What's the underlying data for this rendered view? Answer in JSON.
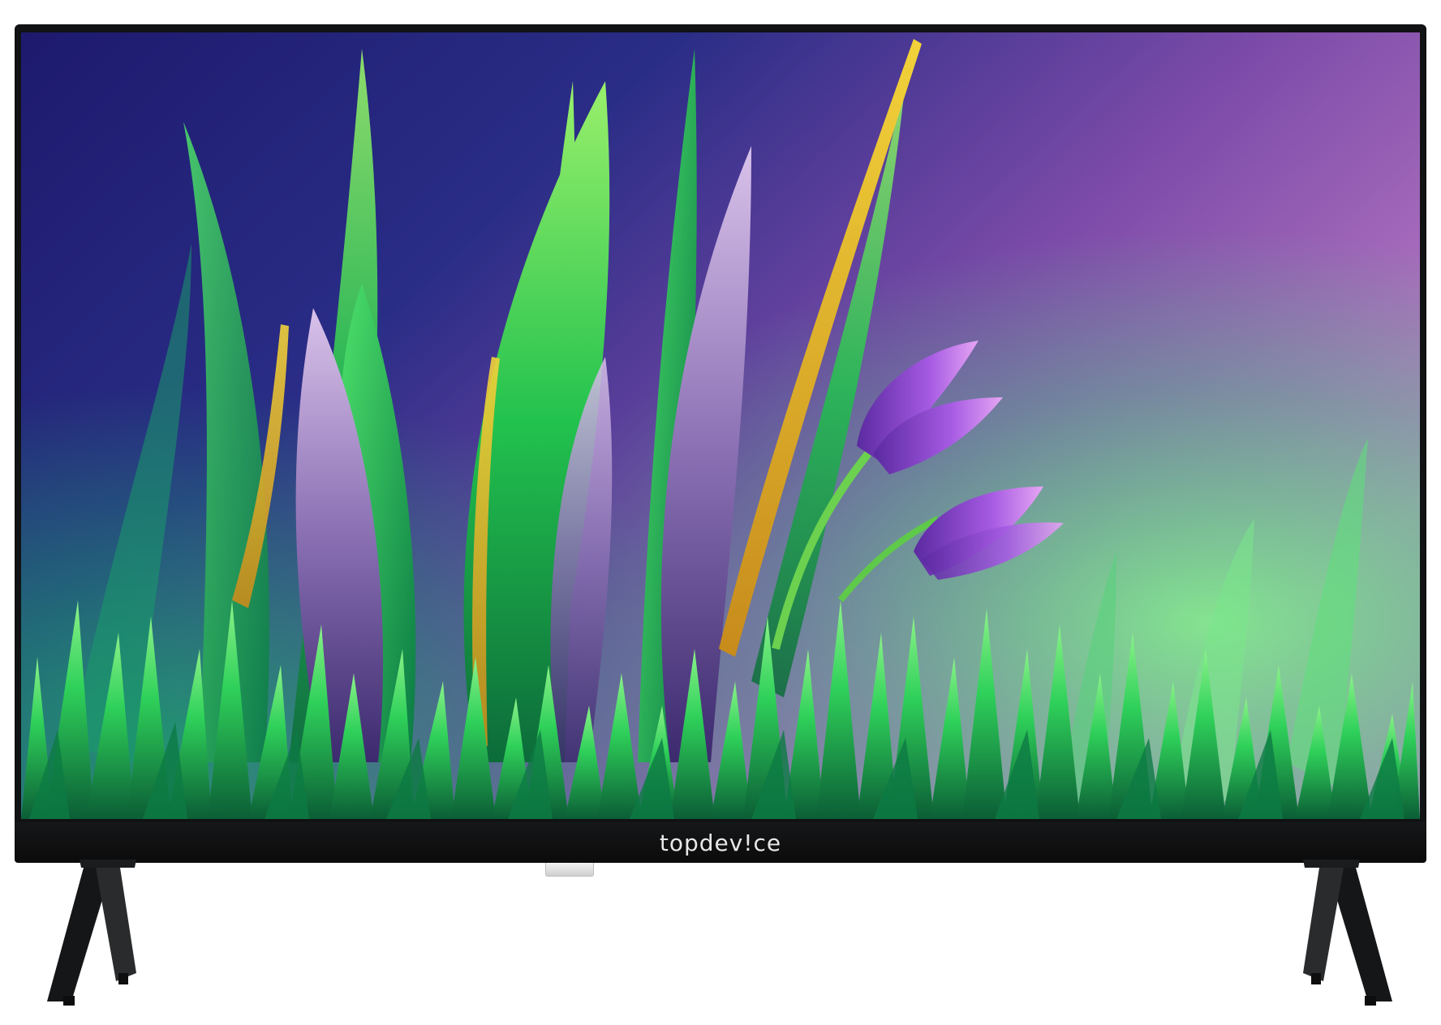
{
  "product": {
    "brand_logo": "topdev!ce"
  },
  "colors": {
    "bezel": "#111213",
    "screen_bg_top_left": "#2a1d73",
    "screen_bg_right": "#b36fc0",
    "grass_green": "#2fd15a",
    "petal_purple": "#a55ae3",
    "logo_text": "#e8e8e8"
  },
  "screen_image": {
    "subject": "grass-and-crocus-buds"
  }
}
